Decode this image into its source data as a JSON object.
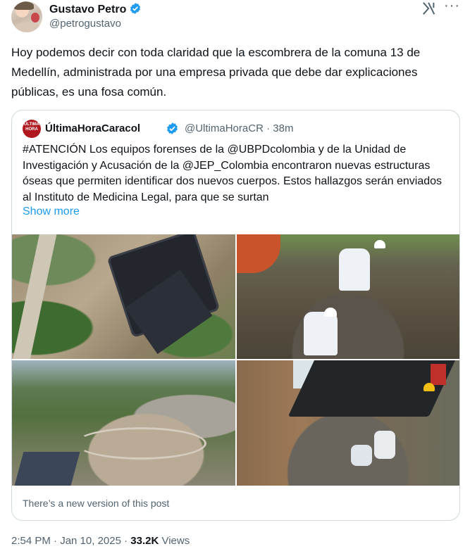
{
  "author": {
    "name": "Gustavo Petro",
    "handle": "@petrogustavo"
  },
  "tweet": {
    "text": "Hoy podemos decir  con toda claridad que la escombrera de la comuna 13 de Medellín, administrada por una empresa privada que debe dar explicaciones públicas, es una fosa común."
  },
  "quote": {
    "avatar_text": "ÚLTIMA HORA",
    "name": "ÚltimaHoraCaracol",
    "handle": "@UltimaHoraCR",
    "time": "· 38m",
    "text": "#ATENCIÓN Los equipos forenses de la @UBPDcolombia  y de la Unidad de Investigación y Acusación de la @JEP_Colombia  encontraron nuevas estructuras óseas que permiten identificar dos nuevos cuerpos. Estos hallazgos serán enviados al Instituto de Medicina Legal, para que se surtan",
    "show_more": "Show more",
    "new_version": "There’s a new version of this post"
  },
  "meta": {
    "time": "2:54 PM · Jan 10, 2025 · ",
    "views_count": "33.2K",
    "views_label": " Views"
  },
  "colors": {
    "verified": "#1d9bf0",
    "link": "#1d9bf0",
    "secondary_text": "#536471"
  }
}
